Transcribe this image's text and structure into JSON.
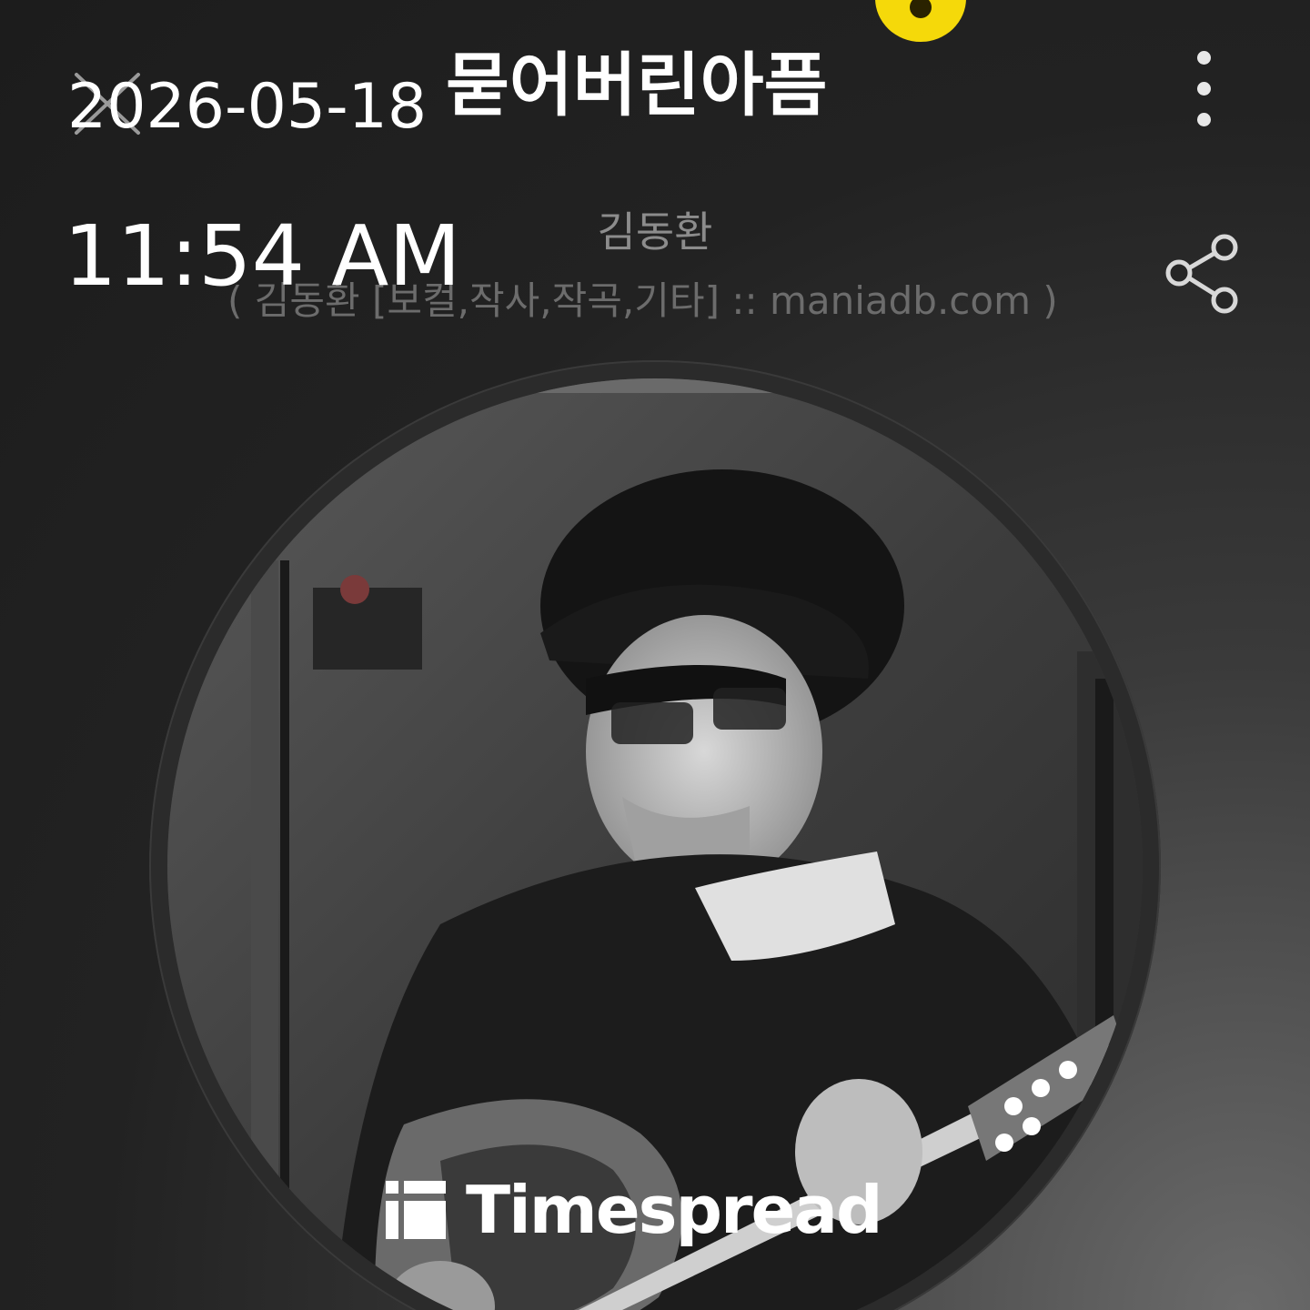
{
  "header": {
    "date": "2026-05-18",
    "time": "11:54 AM",
    "close_icon": "close-x-icon",
    "more_icon": "more-vertical-icon"
  },
  "song": {
    "title": "묻어버린아픔",
    "artist": "김동환",
    "credits": "( 김동환 [보컬,작사,작곡,기타] :: maniadb.com )"
  },
  "actions": {
    "share_icon": "share-icon"
  },
  "album": {
    "art_description_icon": "album-art",
    "watermark_text": "Timespread"
  },
  "colors": {
    "background": "#1c1c1c",
    "accent_badge": "#f5d90a",
    "text_primary": "#ffffff",
    "text_secondary": "#8c8c8c",
    "text_tertiary": "#6c6c6c"
  }
}
